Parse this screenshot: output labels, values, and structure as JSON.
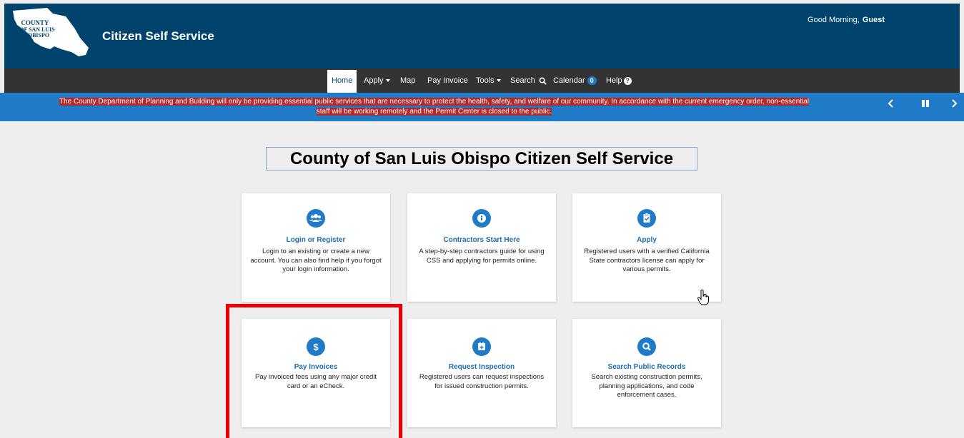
{
  "header": {
    "logo_text": "COUNTY OF SAN LUIS OBISPO",
    "site_title": "Citizen Self Service",
    "greeting": "Good Morning,",
    "user": "Guest"
  },
  "nav": {
    "home": "Home",
    "apply": "Apply",
    "map": "Map",
    "pay_invoice": "Pay Invoice",
    "tools": "Tools",
    "search": "Search",
    "calendar": "Calendar",
    "calendar_count": "0",
    "help": "Help"
  },
  "banner": {
    "line1": "The County Department of Planning and Building will only be providing essential public services that are necessary to protect the health, safety, and welfare of our community. In accordance with the current emergency order, non-essential",
    "line2": "staff will be working remotely and the Permit Center is closed to the public."
  },
  "main": {
    "title": "County of San Luis Obispo Citizen Self Service"
  },
  "cards": [
    {
      "icon": "users-icon",
      "title": "Login or Register",
      "description": "Login to an existing or create a new account. You can also find help if you forgot your login information."
    },
    {
      "icon": "info-icon",
      "title": "Contractors Start Here",
      "description": "A step-by-step contractors guide for using CSS and applying for permits online."
    },
    {
      "icon": "clipboard-check-icon",
      "title": "Apply",
      "description": "Registered users with a verified California State contractors license can apply for various permits."
    },
    {
      "icon": "dollar-icon",
      "title": "Pay Invoices",
      "description": "Pay invoiced fees using any major credit card or an eCheck."
    },
    {
      "icon": "calendar-plus-icon",
      "title": "Request Inspection",
      "description": "Registered users can request inspections for issued construction permits."
    },
    {
      "icon": "search-icon",
      "title": "Search Public Records",
      "description": "Search existing construction permits, planning applications, and code enforcement cases."
    }
  ],
  "colors": {
    "header": "#00446e",
    "nav": "#333333",
    "banner": "#1f7ac8",
    "banner_highlight": "#b42828",
    "accent": "#1f7ac8",
    "highlight_box": "#ee0000"
  }
}
